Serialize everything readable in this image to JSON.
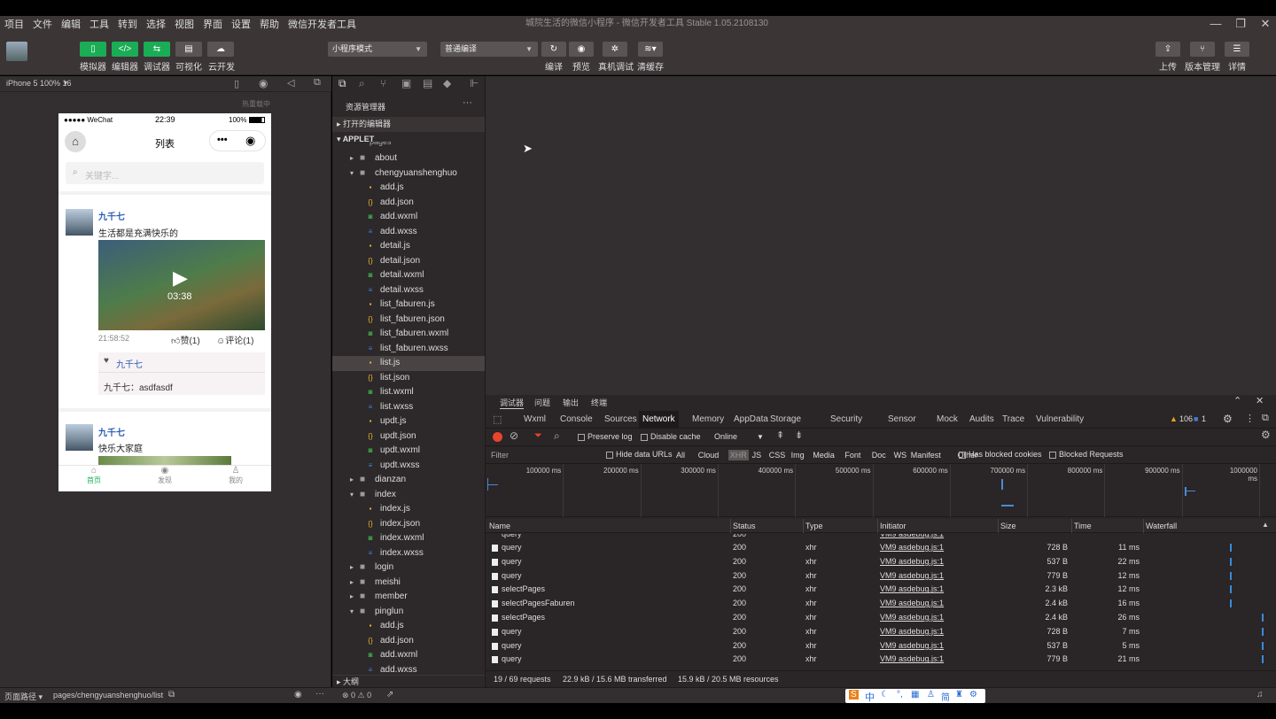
{
  "menu": [
    "项目",
    "文件",
    "编辑",
    "工具",
    "转到",
    "选择",
    "视图",
    "界面",
    "设置",
    "帮助",
    "微信开发者工具"
  ],
  "window_title": "城院生活的微信小程序 - 微信开发者工具 Stable 1.05.2108130",
  "toolbar": {
    "left_buttons": [
      "模拟器",
      "编辑器",
      "调试器",
      "可视化",
      "云开发"
    ],
    "mode_select": "小程序模式",
    "compile_select": "普通编译",
    "mid_buttons": [
      "编译",
      "预览",
      "真机调试",
      "清缓存"
    ],
    "right_buttons": [
      "上传",
      "版本管理",
      "详情"
    ]
  },
  "simulator": {
    "device": "iPhone 5 100% 16",
    "hot_reload": "热重载中",
    "status_carrier": "●●●●● WeChat",
    "status_time": "22:39",
    "status_battery": "100%",
    "nav_title": "列表",
    "search_placeholder": "关键字...",
    "posts": [
      {
        "author": "九千七",
        "text": "生活都是充满快乐的",
        "video_duration": "03:38",
        "time": "21:58:52",
        "like": "赞(1)",
        "comment": "评论(1)",
        "liker": "九千七",
        "comment_text": "九千七：asdfasdf"
      },
      {
        "author": "九千七",
        "text": "快乐大家庭"
      }
    ],
    "tabbar": [
      "首页",
      "发现",
      "我的"
    ]
  },
  "explorer": {
    "title": "资源管理器",
    "open_editors": "打开的编辑器",
    "root": "APPLET",
    "partial_top": "pages",
    "items": [
      {
        "name": "about",
        "type": "folder",
        "open": false,
        "level": 1
      },
      {
        "name": "chengyuanshenghuo",
        "type": "folder",
        "open": true,
        "level": 1
      },
      {
        "name": "add.js",
        "type": "js",
        "level": 2
      },
      {
        "name": "add.json",
        "type": "json",
        "level": 2
      },
      {
        "name": "add.wxml",
        "type": "wxml",
        "level": 2
      },
      {
        "name": "add.wxss",
        "type": "wxss",
        "level": 2
      },
      {
        "name": "detail.js",
        "type": "js",
        "level": 2
      },
      {
        "name": "detail.json",
        "type": "json",
        "level": 2
      },
      {
        "name": "detail.wxml",
        "type": "wxml",
        "level": 2
      },
      {
        "name": "detail.wxss",
        "type": "wxss",
        "level": 2
      },
      {
        "name": "list_faburen.js",
        "type": "js",
        "level": 2
      },
      {
        "name": "list_faburen.json",
        "type": "json",
        "level": 2
      },
      {
        "name": "list_faburen.wxml",
        "type": "wxml",
        "level": 2
      },
      {
        "name": "list_faburen.wxss",
        "type": "wxss",
        "level": 2
      },
      {
        "name": "list.js",
        "type": "js",
        "level": 2,
        "selected": true
      },
      {
        "name": "list.json",
        "type": "json",
        "level": 2
      },
      {
        "name": "list.wxml",
        "type": "wxml",
        "level": 2
      },
      {
        "name": "list.wxss",
        "type": "wxss",
        "level": 2
      },
      {
        "name": "updt.js",
        "type": "js",
        "level": 2
      },
      {
        "name": "updt.json",
        "type": "json",
        "level": 2
      },
      {
        "name": "updt.wxml",
        "type": "wxml",
        "level": 2
      },
      {
        "name": "updt.wxss",
        "type": "wxss",
        "level": 2
      },
      {
        "name": "dianzan",
        "type": "folder",
        "open": false,
        "level": 1
      },
      {
        "name": "index",
        "type": "folder",
        "open": true,
        "level": 1
      },
      {
        "name": "index.js",
        "type": "js",
        "level": 2
      },
      {
        "name": "index.json",
        "type": "json",
        "level": 2
      },
      {
        "name": "index.wxml",
        "type": "wxml",
        "level": 2
      },
      {
        "name": "index.wxss",
        "type": "wxss",
        "level": 2
      },
      {
        "name": "login",
        "type": "folder",
        "open": false,
        "level": 1
      },
      {
        "name": "meishi",
        "type": "folder",
        "open": false,
        "level": 1
      },
      {
        "name": "member",
        "type": "folder",
        "open": false,
        "level": 1
      },
      {
        "name": "pinglun",
        "type": "folder",
        "open": true,
        "level": 1
      },
      {
        "name": "add.js",
        "type": "js",
        "level": 2
      },
      {
        "name": "add.json",
        "type": "json",
        "level": 2
      },
      {
        "name": "add.wxml",
        "type": "wxml",
        "level": 2
      },
      {
        "name": "add.wxss",
        "type": "wxss",
        "level": 2
      }
    ],
    "outline": "大纲"
  },
  "devtools": {
    "panel_tabs": [
      "调试器",
      "问题",
      "输出",
      "终端"
    ],
    "tabs": [
      "Wxml",
      "Console",
      "Sources",
      "Network",
      "Memory",
      "AppData",
      "Storage",
      "Security",
      "Sensor",
      "Mock",
      "Audits",
      "Trace",
      "Vulnerability"
    ],
    "active_tab": "Network",
    "warn_count": "106",
    "err_count": "1",
    "preserve_log": "Preserve log",
    "disable_cache": "Disable cache",
    "throttle": "Online",
    "filter_placeholder": "Filter",
    "hide_data_urls": "Hide data URLs",
    "filter_types": [
      "All",
      "Cloud",
      "XHR",
      "JS",
      "CSS",
      "Img",
      "Media",
      "Font",
      "Doc",
      "WS",
      "Manifest",
      "Other"
    ],
    "has_blocked_cookies": "Has blocked cookies",
    "blocked_requests": "Blocked Requests",
    "timeline_ticks": [
      "100000 ms",
      "200000 ms",
      "300000 ms",
      "400000 ms",
      "500000 ms",
      "600000 ms",
      "700000 ms",
      "800000 ms",
      "900000 ms",
      "1000000 ms"
    ],
    "columns": [
      "Name",
      "Status",
      "Type",
      "Initiator",
      "Size",
      "Time",
      "Waterfall"
    ],
    "rows": [
      {
        "name": "query",
        "status": "200",
        "type": "xhr",
        "initiator": "VM9 asdebug.js:1",
        "size": "728 B",
        "time": "11 ms"
      },
      {
        "name": "query",
        "status": "200",
        "type": "xhr",
        "initiator": "VM9 asdebug.js:1",
        "size": "537 B",
        "time": "22 ms"
      },
      {
        "name": "query",
        "status": "200",
        "type": "xhr",
        "initiator": "VM9 asdebug.js:1",
        "size": "779 B",
        "time": "12 ms"
      },
      {
        "name": "selectPages",
        "status": "200",
        "type": "xhr",
        "initiator": "VM9 asdebug.js:1",
        "size": "2.3 kB",
        "time": "12 ms"
      },
      {
        "name": "selectPagesFaburen",
        "status": "200",
        "type": "xhr",
        "initiator": "VM9 asdebug.js:1",
        "size": "2.4 kB",
        "time": "16 ms"
      },
      {
        "name": "selectPages",
        "status": "200",
        "type": "xhr",
        "initiator": "VM9 asdebug.js:1",
        "size": "2.4 kB",
        "time": "26 ms"
      },
      {
        "name": "query",
        "status": "200",
        "type": "xhr",
        "initiator": "VM9 asdebug.js:1",
        "size": "728 B",
        "time": "7 ms"
      },
      {
        "name": "query",
        "status": "200",
        "type": "xhr",
        "initiator": "VM9 asdebug.js:1",
        "size": "537 B",
        "time": "5 ms"
      },
      {
        "name": "query",
        "status": "200",
        "type": "xhr",
        "initiator": "VM9 asdebug.js:1",
        "size": "779 B",
        "time": "21 ms"
      }
    ],
    "summary": {
      "requests": "19 / 69 requests",
      "transferred": "22.9 kB / 15.6 MB transferred",
      "resources": "15.9 kB / 20.5 MB resources"
    }
  },
  "statusbar": {
    "page_path_label": "页面路径",
    "page_path": "pages/chengyuanshenghuo/list",
    "problems": "⊗ 0 ⚠ 0"
  },
  "ime": "中"
}
